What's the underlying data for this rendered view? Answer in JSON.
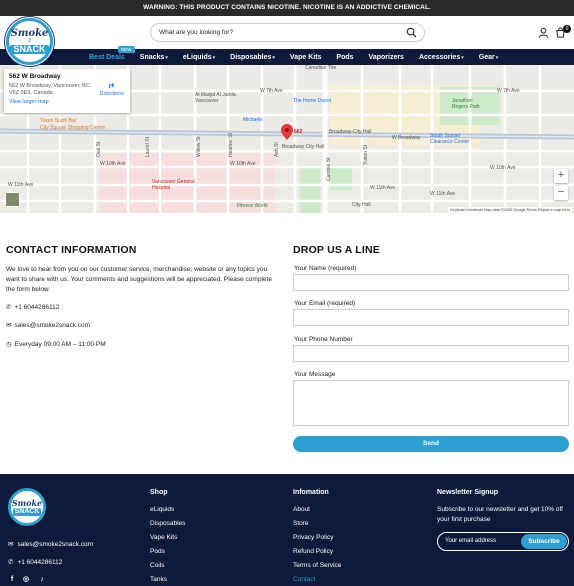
{
  "warning_bar": {
    "text": "WARNING: THIS PRODUCT CONTAINS NICOTINE. NICOTINE IS AN ADDICTIVE CHEMICAL."
  },
  "brand": {
    "logo_line1": "Smoke",
    "logo_line2": "2",
    "logo_line3": "SNACK"
  },
  "search": {
    "placeholder": "What are you looking for?"
  },
  "header": {
    "cart_count": "0"
  },
  "nav": {
    "new_badge": "NEW",
    "items": [
      {
        "label": "Best Deals"
      },
      {
        "label": "Snacks"
      },
      {
        "label": "eLiquids"
      },
      {
        "label": "Disposables"
      },
      {
        "label": "Vape Kits"
      },
      {
        "label": "Pods"
      },
      {
        "label": "Vaporizers"
      },
      {
        "label": "Accessories"
      },
      {
        "label": "Gear"
      }
    ]
  },
  "map": {
    "card_title": "562 W Broadway",
    "card_address": "562 W Broadway, Vancouver, BC V5Z 0E9, Canada",
    "card_link": "View larger map",
    "directions": "Directions",
    "pin_label": "562",
    "labels": [
      "Canadian Tire",
      "W 7th Ave",
      "W 7th Ave",
      "Al Masjid Al Jamia, Vancouver",
      "The Home Depot",
      "Jonathan Rogers Park",
      "Tozen Sushi Bar",
      "Michaels",
      "City Square Shopping Centre",
      "W Broadway",
      "Broadway-City Hall",
      "Broadway City Hall",
      "South Sunset Clearance Center",
      "W 10th Ave",
      "W 10th Ave",
      "W 10th Ave",
      "Vancouver General Hospital",
      "W 11th Ave",
      "W 11th Ave",
      "W 11th Ave",
      "Fitness World",
      "City Hall",
      "Heather St",
      "Ash St",
      "Oak St",
      "Yukon St",
      "Cambie St",
      "Willow St",
      "Laurel St"
    ],
    "footer": "Keyboard shortcuts   Map data ©2025 Google   Terms   Report a map error"
  },
  "contact": {
    "heading": "CONTACT INFORMATION",
    "intro": "We love to hear from you on our customer service, merchandise, website or any topics you want to share with us. Your comments and suggestions will be appreciated. Please complete the form below.",
    "phone": "+1 6044286112",
    "email": "sales@smoke2snack.com",
    "hours": "Everyday 09:00 AM – 11:00 PM"
  },
  "form": {
    "heading": "DROP US A LINE",
    "name_label": "Your Name (required)",
    "email_label": "Your Email (required)",
    "phone_label": "Your Phone Number",
    "message_label": "Your Message",
    "send_label": "Send"
  },
  "footer": {
    "email": "sales@smoke2snack.com",
    "phone": "+1 6044286112",
    "shop_heading": "Shop",
    "shop_links": [
      "eLiquids",
      "Disposables",
      "Vape Kits",
      "Pods",
      "Coils",
      "Tanks"
    ],
    "info_heading": "Infomation",
    "info_links": [
      "About",
      "Store",
      "Privacy Policy",
      "Refund Policy",
      "Terms of Service",
      "Contact"
    ],
    "newsletter_heading": "Newsletter Signup",
    "newsletter_text": "Subscribe to our newsletter and get 10% off your first purchase",
    "newsletter_placeholder": "Your email address",
    "subscribe_label": "Subscribe",
    "social": [
      "facebook-icon",
      "instagram-icon",
      "tiktok-icon"
    ]
  },
  "colors": {
    "accent": "#2e9fd1",
    "navy": "#0e1a3a",
    "warning_bg": "#2b2b2b",
    "pin": "#e53935"
  }
}
